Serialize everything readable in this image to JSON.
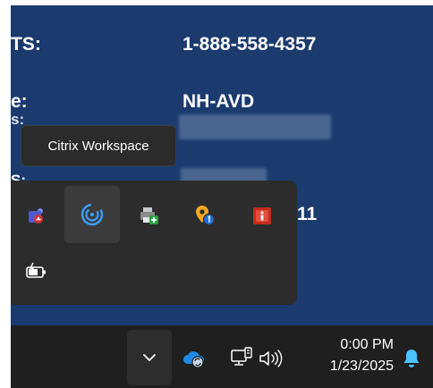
{
  "background_info": {
    "label_1": "TS:",
    "value_1": "1-888-558-4357",
    "label_2": "e:",
    "label_2b": "s:",
    "value_2": "NH-AVD",
    "label_3": "S:",
    "value_3_fragment": "11"
  },
  "tooltip": {
    "text": "Citrix Workspace"
  },
  "tray_flyout": {
    "icons": [
      {
        "name": "teams-icon"
      },
      {
        "name": "citrix-workspace-icon",
        "selected": true
      },
      {
        "name": "printer-add-icon"
      },
      {
        "name": "location-alert-icon"
      },
      {
        "name": "red-info-app-icon"
      },
      {
        "name": "battery-charging-icon"
      }
    ]
  },
  "taskbar": {
    "overflow_icon": "chevron-down-icon",
    "icons": [
      "onedrive-sync-icon",
      "network-icon",
      "volume-icon",
      "notification-bell-icon"
    ],
    "time": "0:00 PM",
    "date": "1/23/2025"
  },
  "colors": {
    "desktop_bg": "#1b3b6f",
    "taskbar_bg": "#1f1f1f",
    "flyout_bg": "#2c2c2c",
    "accent": "#3aa0ff"
  }
}
